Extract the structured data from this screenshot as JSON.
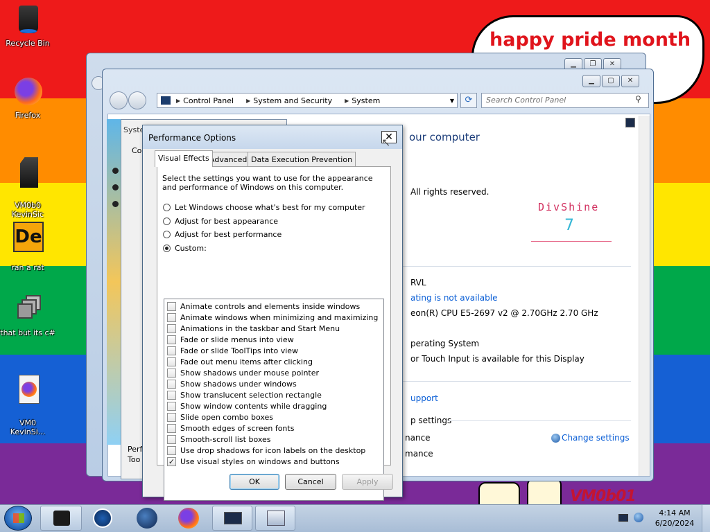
{
  "wallpaper": {
    "speech_text": "happy pride month",
    "signature": "VM0b01"
  },
  "desktop_icons": [
    {
      "label": "Recycle Bin",
      "icon": "recycle-bin-icon"
    },
    {
      "label": "Firefox",
      "icon": "firefox-icon"
    },
    {
      "label": "VM0b0\nKevinSic",
      "icon": "file-icon"
    },
    {
      "label": "ran a rat",
      "icon": "de-app-icon"
    },
    {
      "label": "that but its c#",
      "icon": "stacked-windows-icon"
    },
    {
      "label": "VM0\nKevinSi...",
      "icon": "firefox-file-icon"
    }
  ],
  "explorer": {
    "breadcrumb": [
      "Control Panel",
      "System and Security",
      "System"
    ],
    "search_placeholder": "Search Control Panel",
    "heading_partial": "our computer",
    "copyright_partial": "All rights reserved.",
    "oem_logo": "DivShine",
    "oem_version": "7",
    "processor_label_partial": "RVL",
    "rating_link_partial": "ating is not available",
    "cpu_partial": "eon(R) CPU E5-2697 v2 @ 2.70GHz   2.70 GHz",
    "os_type_partial": "perating System",
    "touch_partial": "or Touch Input is available for this Display",
    "support_link_partial": "upport",
    "settings_partial": "p settings",
    "change_settings": "Change settings",
    "row_partial_1": "nance",
    "row_partial_2": "mance"
  },
  "sysprops": {
    "title_partial": "Syste",
    "tab_partial": "Co",
    "perf_partial_1": "Perf",
    "perf_partial_2": "Too"
  },
  "dialog": {
    "title": "Performance Options",
    "close_glyph": "✕",
    "tabs": [
      "Visual Effects",
      "Advanced",
      "Data Execution Prevention"
    ],
    "description": "Select the settings you want to use for the appearance and performance of Windows on this computer.",
    "radios": [
      {
        "label": "Let Windows choose what's best for my computer",
        "selected": false
      },
      {
        "label": "Adjust for best appearance",
        "selected": false
      },
      {
        "label": "Adjust for best performance",
        "selected": false
      },
      {
        "label": "Custom:",
        "selected": true
      }
    ],
    "effects": [
      {
        "label": "Animate controls and elements inside windows",
        "checked": false
      },
      {
        "label": "Animate windows when minimizing and maximizing",
        "checked": false
      },
      {
        "label": "Animations in the taskbar and Start Menu",
        "checked": false
      },
      {
        "label": "Fade or slide menus into view",
        "checked": false
      },
      {
        "label": "Fade or slide ToolTips into view",
        "checked": false
      },
      {
        "label": "Fade out menu items after clicking",
        "checked": false
      },
      {
        "label": "Show shadows under mouse pointer",
        "checked": false
      },
      {
        "label": "Show shadows under windows",
        "checked": false
      },
      {
        "label": "Show translucent selection rectangle",
        "checked": false
      },
      {
        "label": "Show window contents while dragging",
        "checked": false
      },
      {
        "label": "Slide open combo boxes",
        "checked": false
      },
      {
        "label": "Smooth edges of screen fonts",
        "checked": false
      },
      {
        "label": "Smooth-scroll list boxes",
        "checked": false
      },
      {
        "label": "Use drop shadows for icon labels on the desktop",
        "checked": false
      },
      {
        "label": "Use visual styles on windows and buttons",
        "checked": true
      }
    ],
    "check_glyph": "✓",
    "buttons": {
      "ok": "OK",
      "cancel": "Cancel",
      "apply": "Apply"
    }
  },
  "taskbar": {
    "time": "4:14 AM",
    "date": "6/20/2024"
  }
}
